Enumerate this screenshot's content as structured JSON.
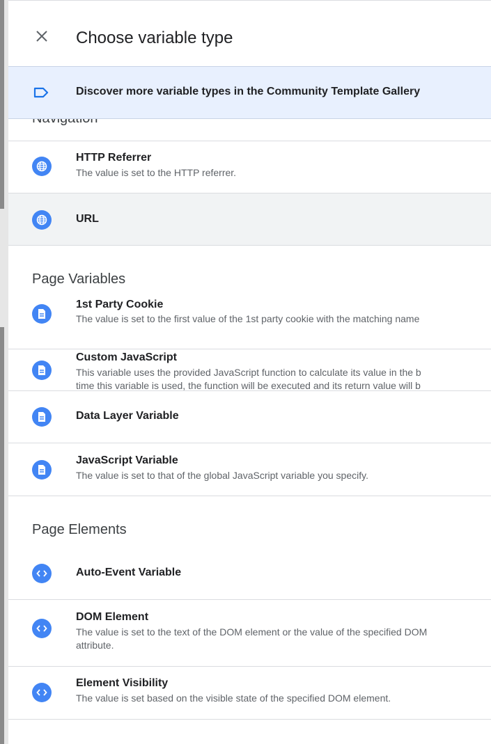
{
  "header": {
    "title": "Choose variable type",
    "close_icon": "close-icon"
  },
  "banner": {
    "icon": "label-tag-icon",
    "text": "Discover more variable types in the Community Template Gallery"
  },
  "sections": [
    {
      "heading": "Navigation",
      "items": [
        {
          "title": "HTTP Referrer",
          "description": "The value is set to the HTTP referrer.",
          "icon": "globe-icon"
        },
        {
          "title": "URL",
          "description": "",
          "icon": "globe-icon",
          "selected": true
        }
      ]
    },
    {
      "heading": "Page Variables",
      "items": [
        {
          "title": "1st Party Cookie",
          "description": "The value is set to the first value of the 1st party cookie with the matching name",
          "icon": "document-icon"
        },
        {
          "title": "Custom JavaScript",
          "description": "This variable uses the provided JavaScript function to calculate its value in the b\ntime this variable is used, the function will be executed and its return value will b",
          "icon": "document-icon"
        },
        {
          "title": "Data Layer Variable",
          "description": "",
          "icon": "document-icon"
        },
        {
          "title": "JavaScript Variable",
          "description": "The value is set to that of the global JavaScript variable you specify.",
          "icon": "document-icon"
        }
      ]
    },
    {
      "heading": "Page Elements",
      "items": [
        {
          "title": "Auto-Event Variable",
          "description": "",
          "icon": "code-icon"
        },
        {
          "title": "DOM Element",
          "description": "The value is set to the text of the DOM element or the value of the specified DOM\nattribute.",
          "icon": "code-icon"
        },
        {
          "title": "Element Visibility",
          "description": "The value is set based on the visible state of the specified DOM element.",
          "icon": "code-icon"
        }
      ]
    }
  ],
  "colors": {
    "accent": "#4285f4",
    "banner_bg": "#e8f0fe",
    "selected_bg": "#f1f3f4"
  }
}
